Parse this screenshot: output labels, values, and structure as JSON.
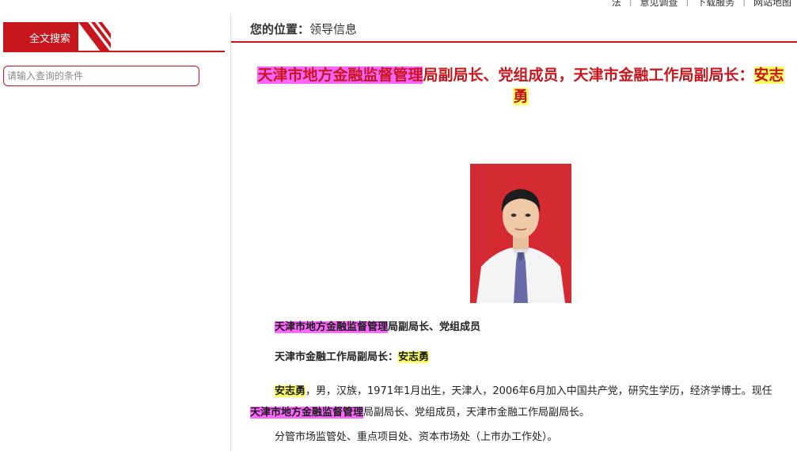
{
  "top_nav": {
    "items": [
      "法",
      "意见调查",
      "下载服务",
      "网站地图"
    ],
    "separator": "|"
  },
  "sidebar": {
    "search_tab_label": "全文搜索",
    "search_placeholder": "请输入查询的条件"
  },
  "breadcrumb": {
    "lead": "您的位置：",
    "current": "领导信息"
  },
  "article": {
    "title_hl1": "天津市地方金融监督管理",
    "title_mid": "局副局长、党组成员，天津市金融工作局副局长：",
    "title_hl2": "安志勇",
    "line1_hl": "天津市地方金融监督管理",
    "line1_rest": "局副局长、党组成员",
    "line2_text": "天津市金融工作局副局长：",
    "line2_hl": "安志勇",
    "bio_name": "安志勇",
    "bio_part1": "，男，汉族，1971年1月出生，天津人，2006年6月加入中国共产党，研究生学历，经济学博士。现任",
    "bio_hl": "天津市地方金融监督管理",
    "bio_part2": "局副局长、党组成员，天津市金融工作局副局长。",
    "duties": "分管市场监管处、重点项目处、资本市场处（上市办工作处）。"
  },
  "colors": {
    "accent": "#c8161d",
    "highlight_pink": "#ff66ff",
    "highlight_yellow": "#ffff66"
  }
}
